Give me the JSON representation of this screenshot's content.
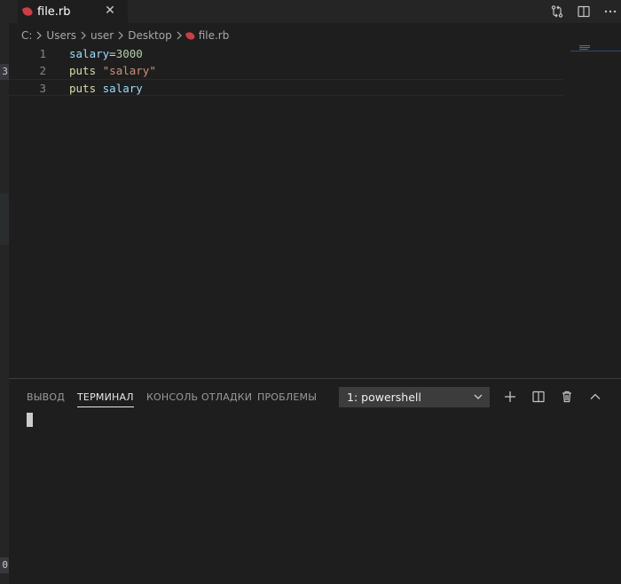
{
  "left_strip": {
    "top_badge": "3",
    "bottom_badge": "0"
  },
  "tab": {
    "label": "file.rb",
    "close_glyph": "✕",
    "icon": "ruby-icon"
  },
  "editor_actions": [
    "compare-changes-icon",
    "split-editor-icon",
    "more-actions-icon"
  ],
  "breadcrumb": {
    "items": [
      "C:",
      "Users",
      "user",
      "Desktop"
    ],
    "file": "file.rb"
  },
  "editor": {
    "lines": [
      {
        "number": "1",
        "tokens": [
          {
            "t": "salary",
            "c": "var"
          },
          {
            "t": "=",
            "c": "op"
          },
          {
            "t": "3000",
            "c": "num"
          }
        ]
      },
      {
        "number": "2",
        "tokens": [
          {
            "t": "puts",
            "c": "fn"
          },
          {
            "t": " ",
            "c": "op"
          },
          {
            "t": "\"salary\"",
            "c": "str"
          }
        ]
      },
      {
        "number": "3",
        "tokens": [
          {
            "t": "puts",
            "c": "fn"
          },
          {
            "t": " ",
            "c": "op"
          },
          {
            "t": "salary",
            "c": "var"
          }
        ]
      }
    ],
    "current_line": 3
  },
  "panel": {
    "tabs": [
      {
        "label": "ВЫВОД",
        "active": false
      },
      {
        "label": "ТЕРМИНАЛ",
        "active": true
      },
      {
        "label": "КОНСОЛЬ ОТЛАДКИ",
        "active": false
      },
      {
        "label": "ПРОБЛЕМЫ",
        "active": false
      }
    ],
    "terminal_select": "1: powershell",
    "actions": [
      "add-terminal-icon",
      "split-terminal-icon",
      "kill-terminal-icon",
      "maximize-panel-icon"
    ]
  },
  "colors": {
    "background": "#1e1e1e",
    "tabbar": "#252526",
    "ruby": "#cc3e44",
    "variable": "#9cdcfe",
    "function": "#dcdcaa",
    "string": "#ce9178",
    "number": "#b5cea8"
  }
}
